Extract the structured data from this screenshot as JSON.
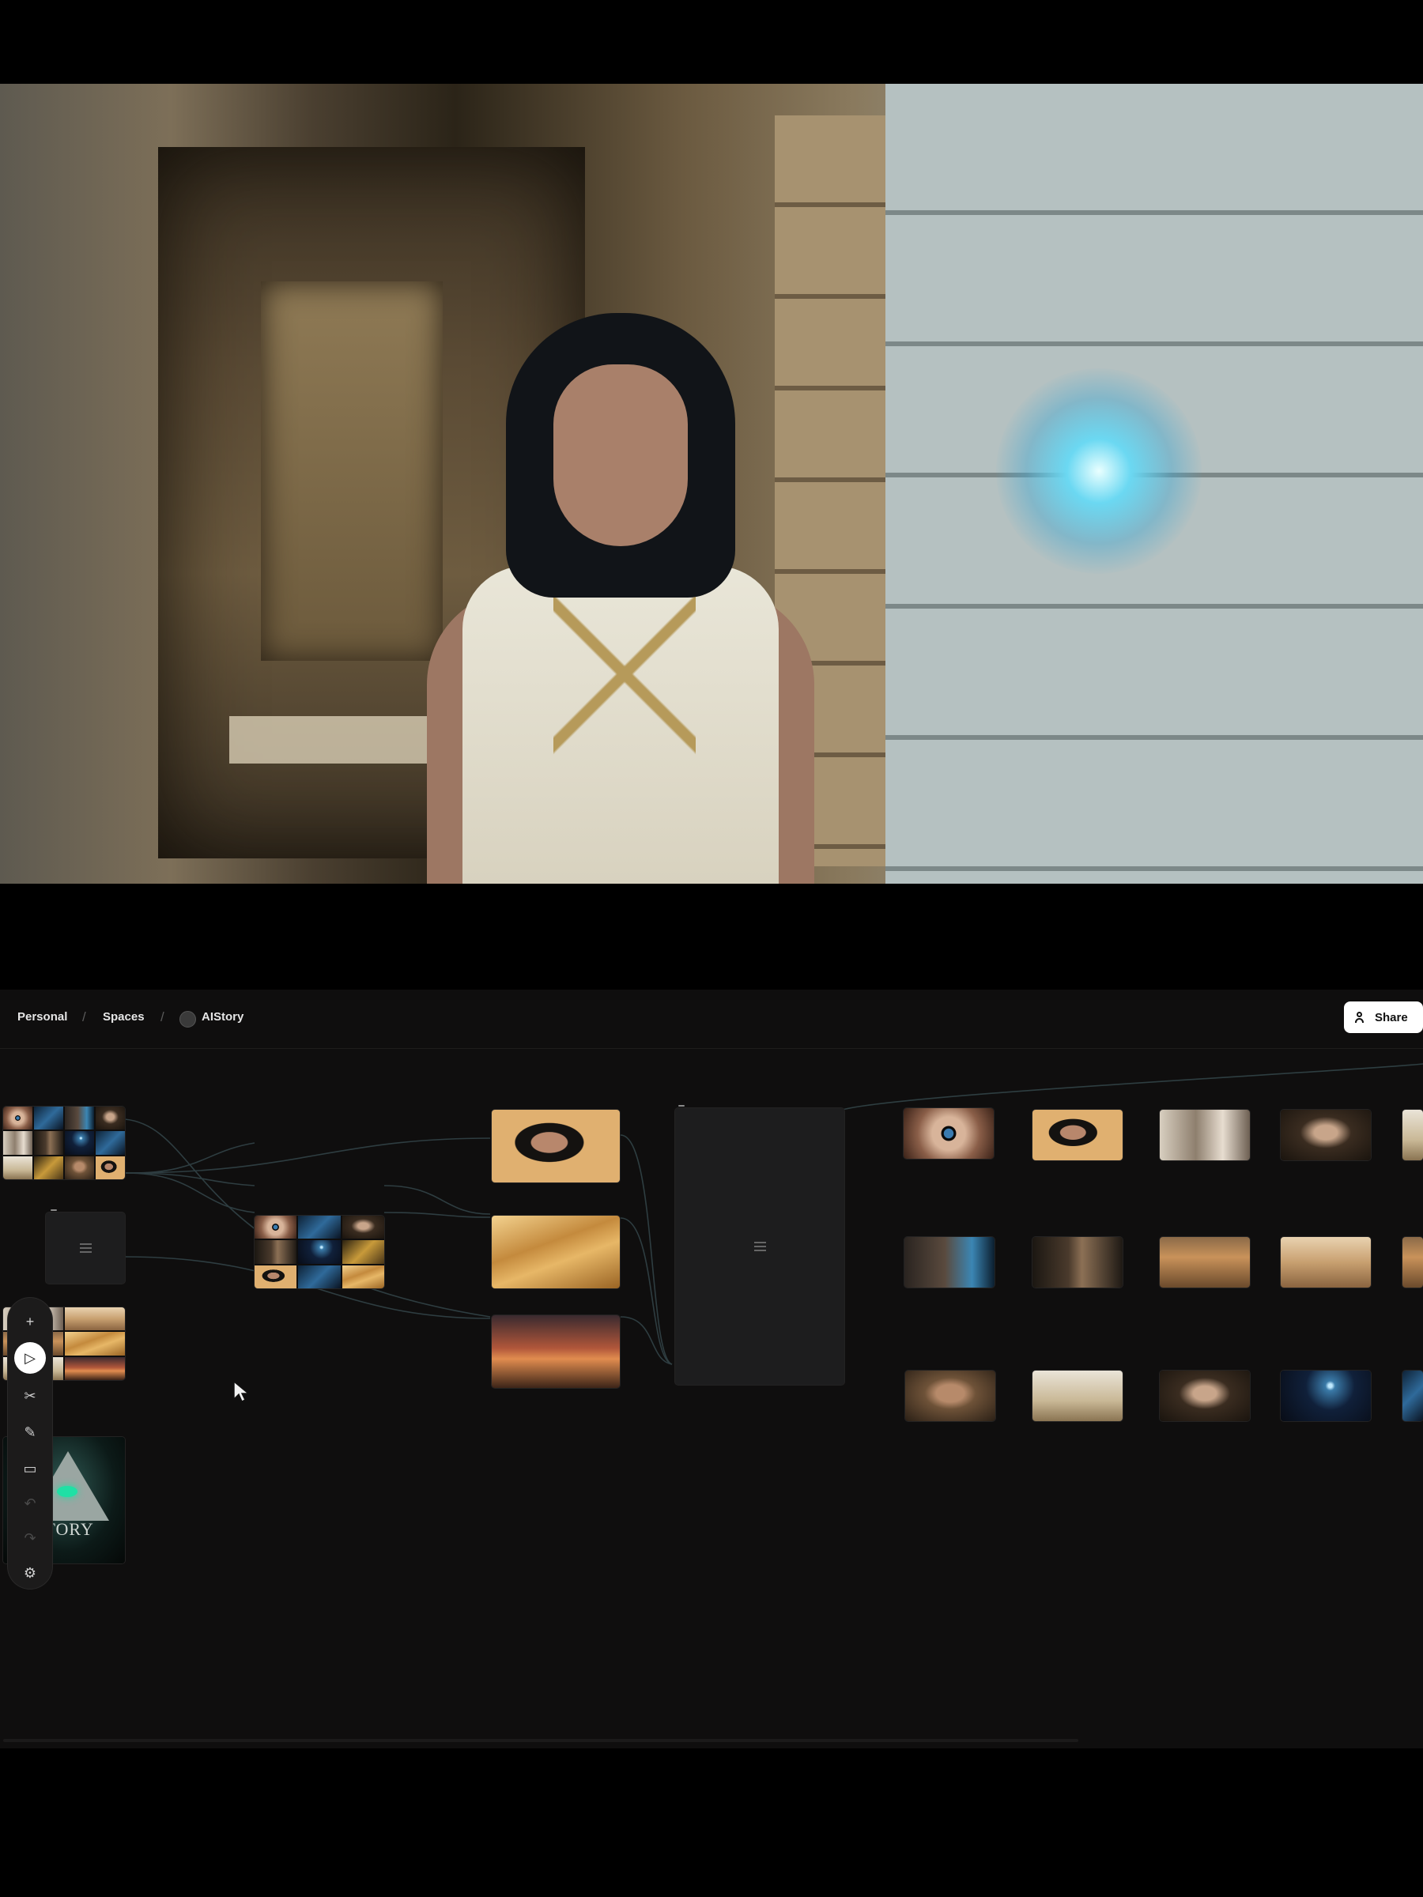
{
  "breadcrumb": {
    "personal": "Personal",
    "spaces": "Spaces",
    "space_name": "AIStory",
    "separator": "/"
  },
  "share_button": {
    "label": "Share",
    "icon": "people-icon"
  },
  "poster": {
    "text": "STORY"
  },
  "toolbar": {
    "tools": [
      {
        "name": "add",
        "icon": "plus-icon",
        "glyph": "+",
        "active": false
      },
      {
        "name": "select",
        "icon": "pointer-icon",
        "glyph": "▷",
        "active": true
      },
      {
        "name": "cut",
        "icon": "scissors-icon",
        "glyph": "✂",
        "active": false
      },
      {
        "name": "draw",
        "icon": "pen-icon",
        "glyph": "✎",
        "active": false
      },
      {
        "name": "comment",
        "icon": "comment-icon",
        "glyph": "▭",
        "active": false
      },
      {
        "name": "undo",
        "icon": "undo-icon",
        "glyph": "↶",
        "active": false
      },
      {
        "name": "redo",
        "icon": "redo-icon",
        "glyph": "↷",
        "active": false
      },
      {
        "name": "settings",
        "icon": "gear-icon",
        "glyph": "⚙",
        "active": false
      }
    ]
  },
  "colors": {
    "canvas": "#0f0e0e",
    "node_empty": "#1d1d1e",
    "link": "#3a4a4e",
    "share_bg": "#ffffff"
  }
}
